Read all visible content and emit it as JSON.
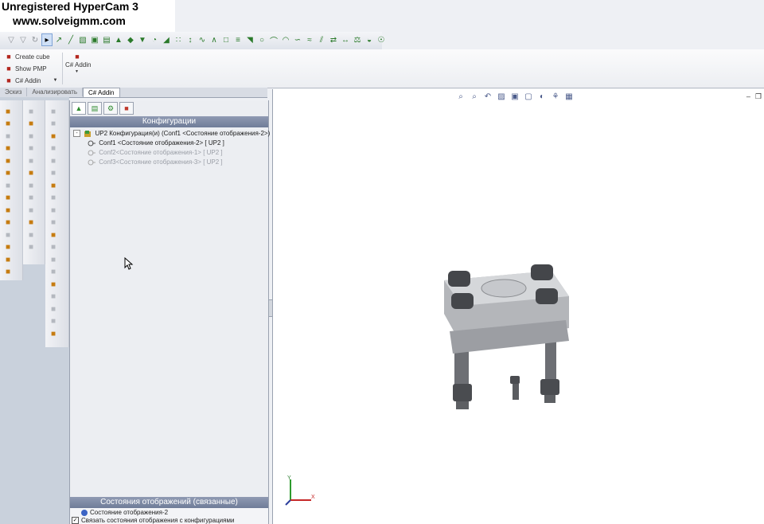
{
  "watermark": {
    "line1": "Unregistered HyperCam 3",
    "line2": "www.solveigmm.com"
  },
  "top_toolbar": {
    "icons": [
      "filter-icon",
      "filter-icon",
      "rotate-icon",
      "select-arrow-icon",
      "pointer-icon",
      "line-icon",
      "sketch-icon",
      "box-icon",
      "folder-icon",
      "extrude-icon",
      "surface-icon",
      "cut-icon",
      "fillet-icon",
      "chamfer-icon",
      "pattern-icon",
      "mirror-icon",
      "sweep-icon",
      "loft-icon",
      "shell-icon",
      "rib-icon",
      "draft-icon",
      "hole-icon",
      "wrap-icon",
      "dome-icon",
      "flex-icon",
      "deform-icon",
      "split-icon",
      "move-icon",
      "measure-icon",
      "mass-icon",
      "section-icon",
      "sensor-icon"
    ]
  },
  "ribbon": {
    "create_cube": "Create cube",
    "show_pmp": "Show PMP",
    "csharp_addin": "C# Addin",
    "csharp_addin_big": "C# Addin"
  },
  "tabs": [
    "Эскиз",
    "Анализировать",
    "C# Addin"
  ],
  "feature_manager": {
    "config_header": "Конфигурации",
    "root": "UP2 Конфигурация(и)  (Conf1 <Состояние отображения-2>)",
    "items": [
      {
        "label": "Conf1 <Состояние отображения-2> [ UP2 ]",
        "active": true
      },
      {
        "label": "Conf2<Состояние отображения-1> [ UP2 ]",
        "active": false
      },
      {
        "label": "Conf3<Состояние отображения-3> [ UP2 ]",
        "active": false
      }
    ],
    "display_states_header": "Состояния отображений (связанные)",
    "display_state_item": "Состояние отображения-2",
    "link_checkbox": {
      "label": "Связать состояния отображения с конфигурациями",
      "checked": true
    }
  },
  "graphics": {
    "axis_x": "X",
    "axis_y": "Y",
    "heads_up_icons": [
      "zoom-fit-icon",
      "zoom-area-icon",
      "previous-view-icon",
      "section-view-icon",
      "view-orientation-icon",
      "display-style-icon",
      "hide-show-icon",
      "edit-appearance-icon",
      "scene-icon"
    ]
  },
  "colors": {
    "accent": "#6f7c98",
    "graphics_bg": "#ffffff"
  }
}
